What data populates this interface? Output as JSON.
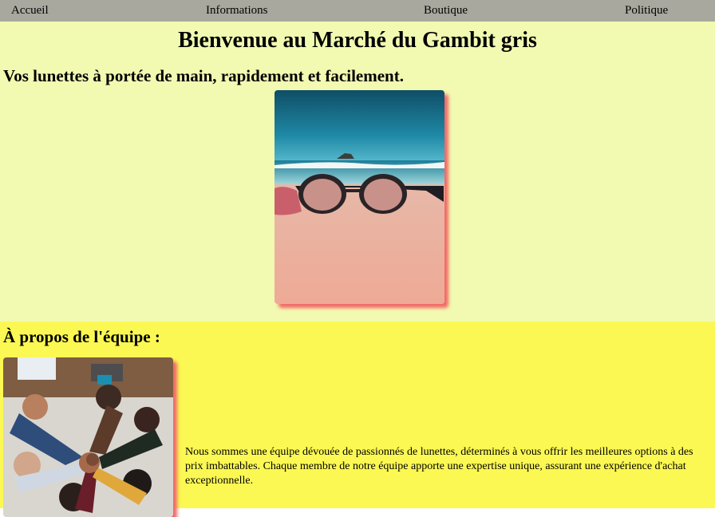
{
  "nav": {
    "items": [
      "Accueil",
      "Informations",
      "Boutique",
      "Politique"
    ]
  },
  "hero": {
    "title": "Bienvenue au Marché du Gambit gris",
    "subtitle": "Vos lunettes à portée de main, rapidement et facilement."
  },
  "team": {
    "title": "À propos de l'équipe :",
    "description": "Nous sommes une équipe dévouée de passionnés de lunettes, déterminés à vous offrir les meilleures options à des prix imbattables. Chaque membre de notre équipe apporte une expertise unique, assurant une expérience d'achat exceptionnelle."
  },
  "colors": {
    "nav_bg": "#a8a89e",
    "hero_bg": "#f2f9b1",
    "team_bg": "#fbf853",
    "image_shadow": "#f06a6a"
  }
}
